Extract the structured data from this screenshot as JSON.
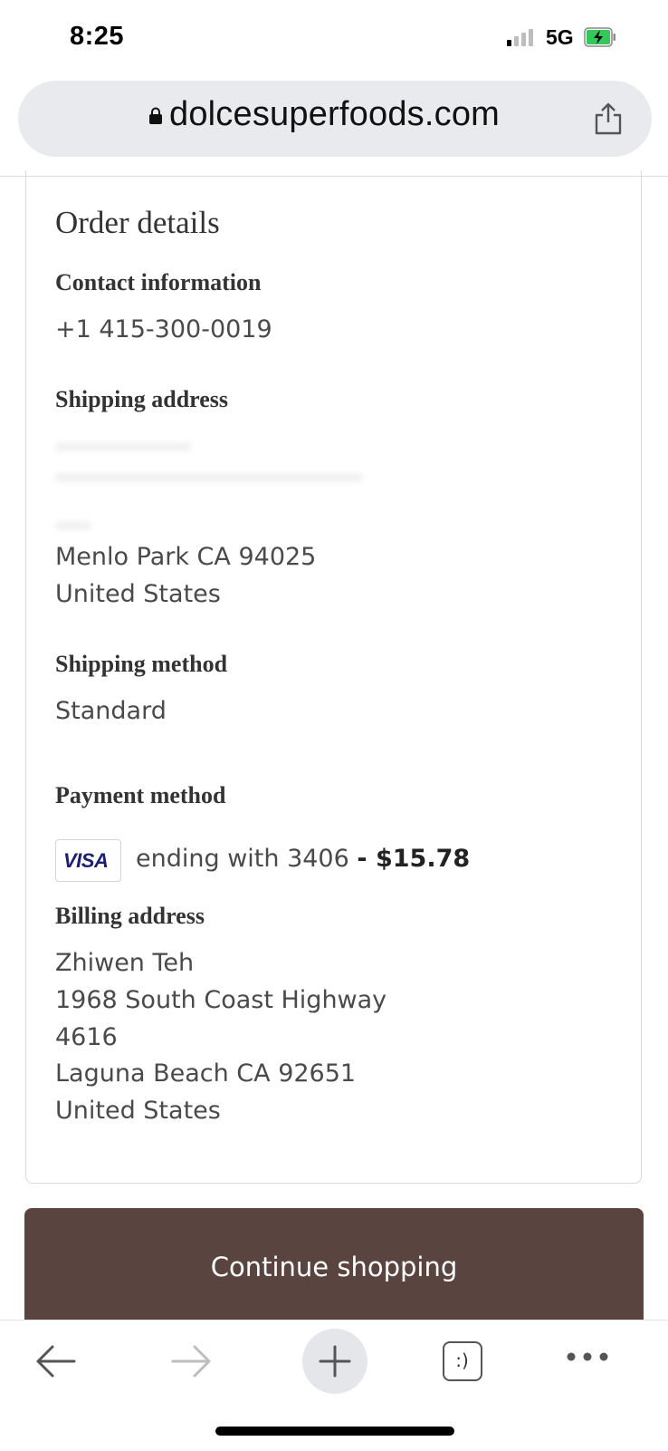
{
  "status_bar": {
    "time": "8:25",
    "network": "5G"
  },
  "browser": {
    "url": "dolcesuperfoods.com"
  },
  "order": {
    "title": "Order details",
    "contact": {
      "heading": "Contact information",
      "phone": "+1 415-300-0019"
    },
    "shipping_address": {
      "heading": "Shipping address",
      "city_line": "Menlo Park CA 94025",
      "country": "United States"
    },
    "shipping_method": {
      "heading": "Shipping method",
      "value": "Standard"
    },
    "payment": {
      "heading": "Payment method",
      "card_brand": "VISA",
      "ending": "ending with 3406",
      "amount": "- $15.78"
    },
    "billing_address": {
      "heading": "Billing address",
      "lines": [
        "Zhiwen Teh",
        "1968 South Coast Highway",
        "4616",
        "Laguna Beach CA 92651",
        "United States"
      ]
    }
  },
  "actions": {
    "continue_label": "Continue shopping"
  },
  "toolbar": {
    "tabs_icon_text": ":)"
  }
}
